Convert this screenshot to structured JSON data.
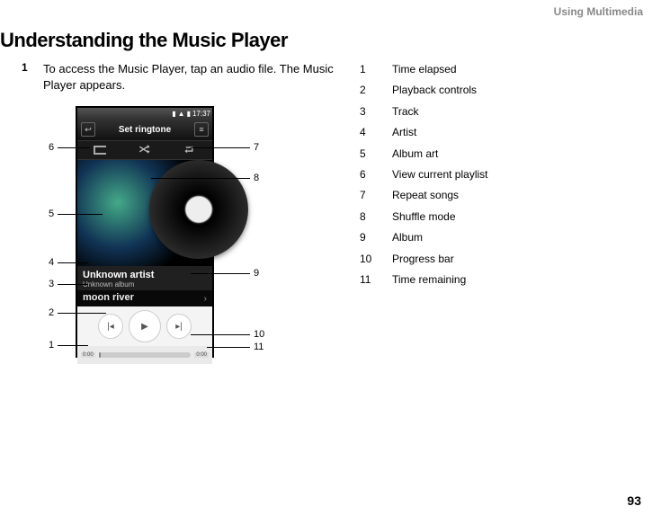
{
  "chapter": "Using Multimedia",
  "heading": "Understanding the Music Player",
  "step_num": "1",
  "step_text": "To access the Music Player, tap an audio file. The Music Player appears.",
  "phone": {
    "status_time": "17:37",
    "title": "Set ringtone",
    "artist": "Unknown artist",
    "album": "Unknown album",
    "track": "moon river",
    "time_elapsed": "0:00",
    "time_remaining": "0:00"
  },
  "callouts": {
    "c1": "1",
    "c2": "2",
    "c3": "3",
    "c4": "4",
    "c5": "5",
    "c6": "6",
    "c7": "7",
    "c8": "8",
    "c9": "9",
    "c10": "10",
    "c11": "11"
  },
  "legend": [
    {
      "n": "1",
      "t": "Time elapsed"
    },
    {
      "n": "2",
      "t": "Playback controls"
    },
    {
      "n": "3",
      "t": "Track"
    },
    {
      "n": "4",
      "t": "Artist"
    },
    {
      "n": "5",
      "t": "Album art"
    },
    {
      "n": "6",
      "t": "View current playlist"
    },
    {
      "n": "7",
      "t": "Repeat songs"
    },
    {
      "n": "8",
      "t": "Shuffle mode"
    },
    {
      "n": "9",
      "t": "Album"
    },
    {
      "n": "10",
      "t": "Progress bar"
    },
    {
      "n": "11",
      "t": "Time remaining"
    }
  ],
  "page_num": "93"
}
